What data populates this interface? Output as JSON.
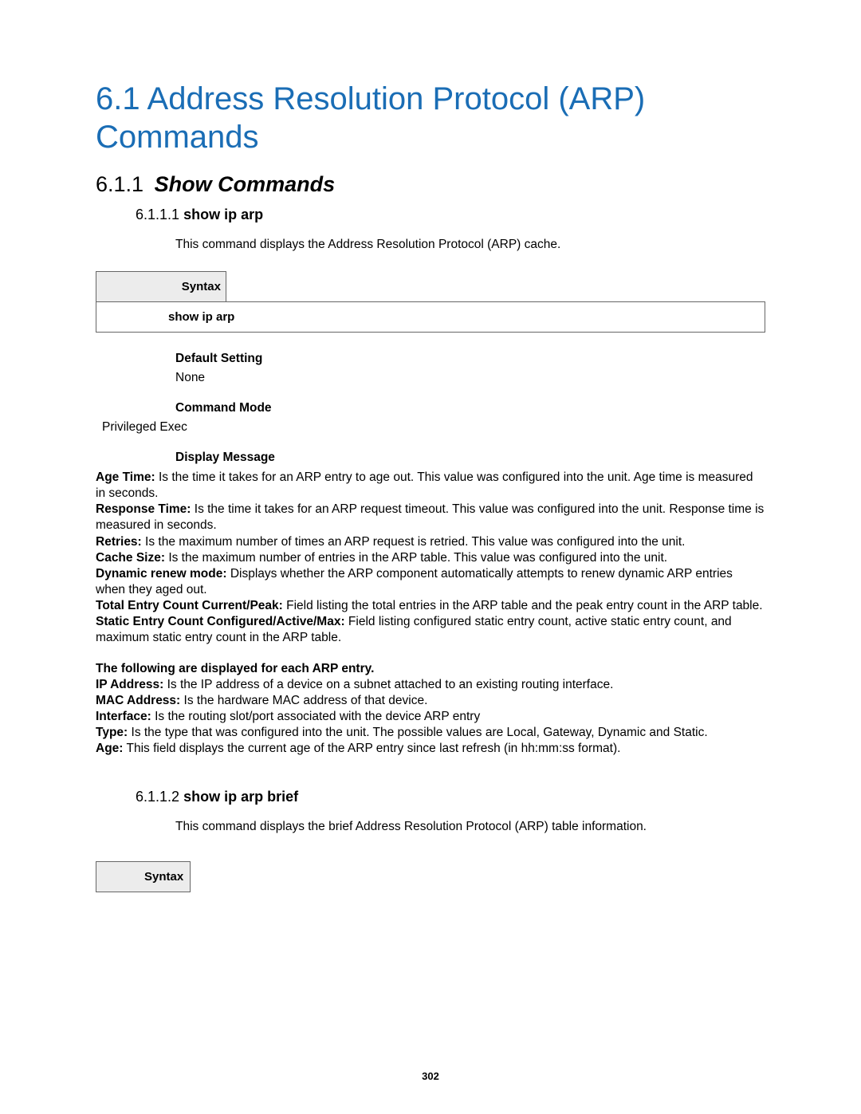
{
  "h1": "6.1 Address Resolution Protocol (ARP) Commands",
  "h2_num": "6.1.1",
  "h2_title": "Show Commands",
  "sec1": {
    "num": "6.1.1.1",
    "title": "show ip arp",
    "intro": "This command displays the Address Resolution Protocol (ARP) cache.",
    "syntax_label": "Syntax",
    "syntax_body": "show ip arp",
    "default_label": "Default Setting",
    "default_value": "None",
    "mode_label": "Command Mode",
    "mode_value": "Privileged Exec",
    "display_label": "Display Message",
    "items": [
      {
        "k": "Age Time:",
        "v": " Is the time it takes for an ARP entry to age out. This value was configured into the unit. Age time is measured in seconds."
      },
      {
        "k": "Response Time:",
        "v": " Is the time it takes for an ARP request timeout. This value was configured into the unit. Response time is measured in seconds."
      },
      {
        "k": "Retries:",
        "v": " Is the maximum number of times an ARP request is retried. This value was configured into the unit."
      },
      {
        "k": "Cache Size:",
        "v": " Is the maximum number of entries in the ARP table. This value was configured into the unit."
      },
      {
        "k": "Dynamic renew mode:",
        "v": " Displays whether the ARP component automatically attempts to renew dynamic ARP entries when they aged out."
      },
      {
        "k": "Total Entry Count Current/Peak:",
        "v": " Field listing the total entries in the ARP table and the peak entry count in the ARP table."
      },
      {
        "k": "Static Entry Count Configured/Active/Max:",
        "v": " Field listing configured static entry count, active static entry count, and maximum static entry count in the ARP table."
      }
    ],
    "each_label": "The following are displayed for each ARP entry.",
    "each_items": [
      {
        "k": "IP Address:",
        "v": " Is the IP address of a device on a subnet attached to an existing routing interface."
      },
      {
        "k": "MAC Address:",
        "v": " Is the hardware MAC address of that device."
      },
      {
        "k": "Interface:",
        "v": " Is the routing slot/port associated with the device ARP entry"
      },
      {
        "k": "Type:",
        "v": " Is the type that was configured into the unit. The possible values are Local, Gateway, Dynamic and Static."
      },
      {
        "k": "Age:",
        "v": " This field displays the current age of the ARP entry since last refresh (in hh:mm:ss format)."
      }
    ]
  },
  "sec2": {
    "num": "6.1.1.2",
    "title": "show ip arp brief",
    "intro": "This command displays the brief Address Resolution Protocol (ARP) table information.",
    "syntax_label": "Syntax"
  },
  "page_number": "302"
}
